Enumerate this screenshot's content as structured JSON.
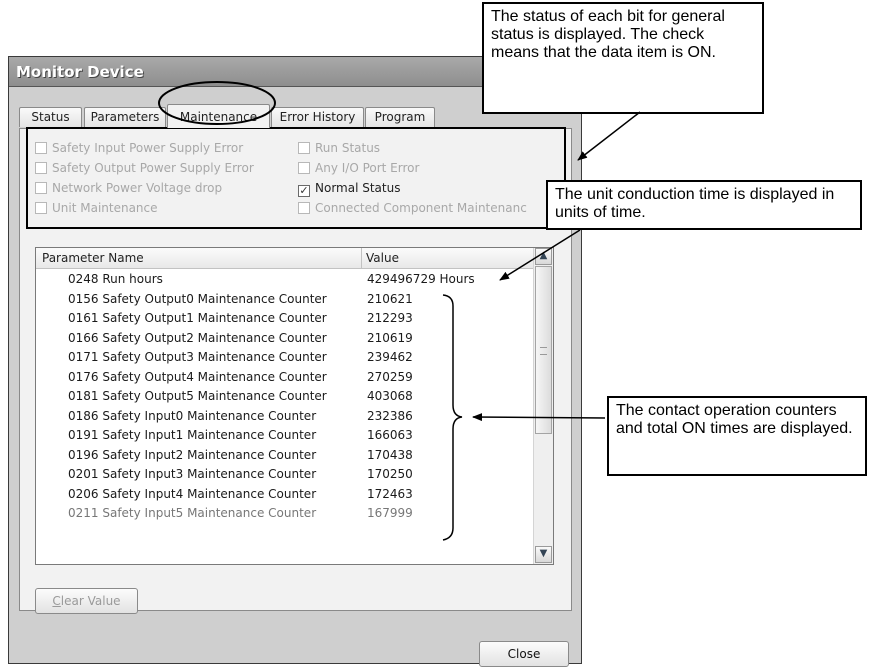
{
  "window": {
    "title": "Monitor Device"
  },
  "tabs": [
    {
      "label": "Status"
    },
    {
      "label": "Parameters"
    },
    {
      "label": "Maintenance"
    },
    {
      "label": "Error History"
    },
    {
      "label": "Program"
    }
  ],
  "status_checkboxes": [
    {
      "label": "Safety Input Power Supply Error",
      "checked": false
    },
    {
      "label": "Safety Output Power Supply Error",
      "checked": false
    },
    {
      "label": "Network Power Voltage drop",
      "checked": false
    },
    {
      "label": "Unit Maintenance",
      "checked": false
    },
    {
      "label": "Run Status",
      "checked": false
    },
    {
      "label": "Any I/O Port Error",
      "checked": false
    },
    {
      "label": "Normal Status",
      "checked": true
    },
    {
      "label": "Connected Component Maintenanc",
      "checked": false
    }
  ],
  "table": {
    "headers": [
      "Parameter Name",
      "Value"
    ],
    "rows": [
      {
        "name": "0248 Run hours",
        "value": "429496729 Hours"
      },
      {
        "name": "0156 Safety Output0 Maintenance Counter",
        "value": "210621"
      },
      {
        "name": "0161 Safety Output1 Maintenance Counter",
        "value": "212293"
      },
      {
        "name": "0166 Safety Output2 Maintenance Counter",
        "value": "210619"
      },
      {
        "name": "0171 Safety Output3 Maintenance Counter",
        "value": "239462"
      },
      {
        "name": "0176 Safety Output4 Maintenance Counter",
        "value": "270259"
      },
      {
        "name": "0181 Safety Output5 Maintenance Counter",
        "value": "403068"
      },
      {
        "name": "0186 Safety Input0 Maintenance Counter",
        "value": "232386"
      },
      {
        "name": "0191 Safety Input1 Maintenance Counter",
        "value": "166063"
      },
      {
        "name": "0196 Safety Input2 Maintenance Counter",
        "value": "170438"
      },
      {
        "name": "0201 Safety Input3 Maintenance Counter",
        "value": "170250"
      },
      {
        "name": "0206 Safety Input4 Maintenance Counter",
        "value": "172463"
      },
      {
        "name": "0211 Safety Input5 Maintenance Counter",
        "value": "167999"
      }
    ]
  },
  "buttons": {
    "clear_value": "Clear Value",
    "clear_value_mnemonic": "C",
    "clear_value_rest": "lear Value",
    "close": "Close"
  },
  "callouts": {
    "status_bits": "The status of each bit for general status is displayed. The check means that the data item is ON.",
    "conduction_time": "The unit conduction time is displayed in units of time.",
    "counters": "The contact operation counters and total ON times are displayed."
  }
}
